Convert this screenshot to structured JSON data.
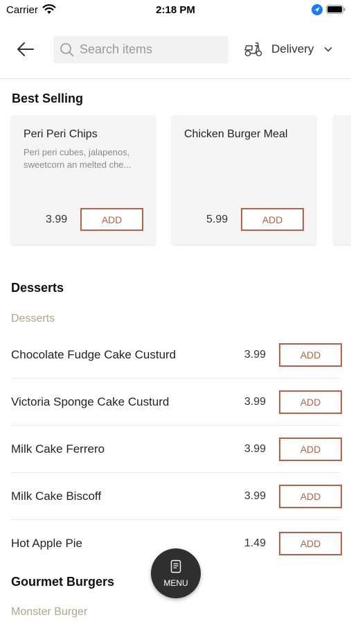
{
  "status_bar": {
    "carrier": "Carrier",
    "time": "2:18 PM"
  },
  "header": {
    "search_placeholder": "Search items",
    "delivery_label": "Delivery"
  },
  "best_selling": {
    "title": "Best Selling",
    "items": [
      {
        "name": "Peri Peri Chips",
        "description": "Peri peri cubes, jalapenos, sweetcorn an melted che...",
        "price": "3.99",
        "add_label": "ADD"
      },
      {
        "name": "Chicken Burger Meal",
        "description": "",
        "price": "5.99",
        "add_label": "ADD"
      }
    ]
  },
  "desserts": {
    "title": "Desserts",
    "subtitle": "Desserts",
    "items": [
      {
        "name": "Chocolate Fudge Cake Custurd",
        "price": "3.99",
        "add_label": "ADD"
      },
      {
        "name": "Victoria Sponge Cake Custurd",
        "price": "3.99",
        "add_label": "ADD"
      },
      {
        "name": "Milk Cake Ferrero",
        "price": "3.99",
        "add_label": "ADD"
      },
      {
        "name": "Milk Cake Biscoff",
        "price": "3.99",
        "add_label": "ADD"
      },
      {
        "name": "Hot Apple Pie",
        "price": "1.49",
        "add_label": "ADD"
      }
    ]
  },
  "gourmet_burgers": {
    "title": "Gourmet Burgers",
    "subtitle": "Monster Burger"
  },
  "menu_button": {
    "label": "MENU"
  },
  "colors": {
    "accent": "#b7604a",
    "subtitle": "#b0a58c",
    "fab": "#2f2f2f"
  }
}
